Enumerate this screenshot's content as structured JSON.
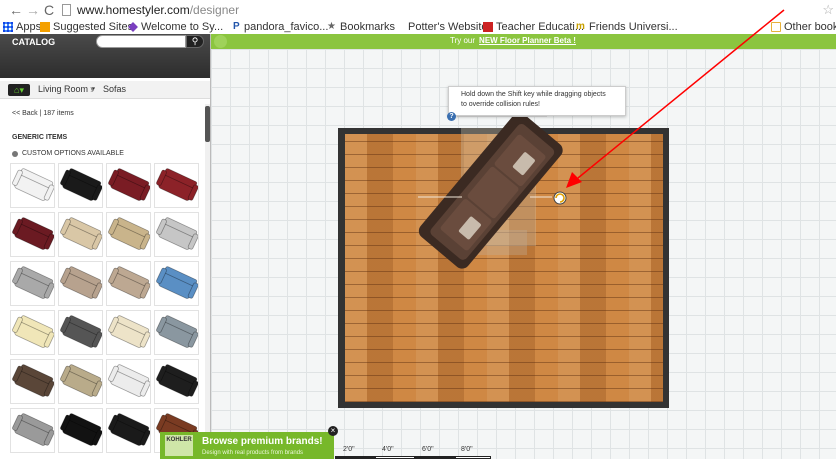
{
  "browser": {
    "url_domain": "www.homestyler.com",
    "url_path": "/designer",
    "back_glyph": "←",
    "forward_glyph": "→",
    "reload_glyph": "C",
    "star_glyph": "☆",
    "bookmarks": [
      {
        "label": "Apps",
        "icon": "apps-grid-icon",
        "color": "#4285f4"
      },
      {
        "label": "Suggested Sites",
        "icon": "suggested-sites-icon",
        "color": "#f4a000"
      },
      {
        "label": "Welcome to Sy...",
        "icon": "welcome-icon",
        "color": "#7a3fc0"
      },
      {
        "label": "pandora_favico...",
        "icon": "pandora-icon",
        "color": "#2255aa"
      },
      {
        "label": "Bookmarks",
        "icon": "star-icon",
        "color": "#666666"
      },
      {
        "label": "Potter's Website",
        "icon": "none",
        "color": ""
      },
      {
        "label": "Teacher Educati...",
        "icon": "teacher-edu-icon",
        "color": "#cc2222"
      },
      {
        "label": "Friends Universi...",
        "icon": "friends-univ-icon",
        "color": "#c8a000"
      },
      {
        "label": "Other bookm",
        "icon": "folder-icon",
        "color": "#e7b13a"
      }
    ]
  },
  "catalog": {
    "title": "CATALOG",
    "search_placeholder": "",
    "search_glyph": "⚲",
    "home_glyph": "⌂▾",
    "room": "Living Room ▾",
    "category": "Sofas",
    "back_text": "<< Back | 187 items",
    "section_heading": "GENERIC ITEMS",
    "custom_options": "CUSTOM OPTIONS AVAILABLE",
    "items": [
      {
        "name": "sofa-white-loveseat",
        "color": "#f2f2f2"
      },
      {
        "name": "sofa-black-leather",
        "color": "#1a1a1a"
      },
      {
        "name": "sofa-burgundy",
        "color": "#7a1c24"
      },
      {
        "name": "sofa-red-leather",
        "color": "#8c2228"
      },
      {
        "name": "sofa-maroon",
        "color": "#6b1a22"
      },
      {
        "name": "sofa-cream-brown",
        "color": "#d9c7a6"
      },
      {
        "name": "sofa-tan-black",
        "color": "#c9b48b"
      },
      {
        "name": "sofa-light-grey",
        "color": "#c6c6c6"
      },
      {
        "name": "sofa-grey-fabric",
        "color": "#a9a9a9"
      },
      {
        "name": "sofa-taupe",
        "color": "#b7a28e"
      },
      {
        "name": "sofa-beige-stripe",
        "color": "#bda892"
      },
      {
        "name": "sofa-sectional-blue",
        "color": "#5a8fc4"
      },
      {
        "name": "chaise-cream",
        "color": "#f0e6b8"
      },
      {
        "name": "chair-dark-grey",
        "color": "#555555"
      },
      {
        "name": "sofa-ivory",
        "color": "#ede3c8"
      },
      {
        "name": "sofa-sectional-grey",
        "color": "#8a97a0"
      },
      {
        "name": "sectional-brown",
        "color": "#5a4638"
      },
      {
        "name": "sofa-khaki",
        "color": "#b9ab8a"
      },
      {
        "name": "sectional-white",
        "color": "#ececec"
      },
      {
        "name": "sofa-black",
        "color": "#1e1e1e"
      },
      {
        "name": "sofa-grey-pleated",
        "color": "#9a9a9a"
      },
      {
        "name": "sectional-black",
        "color": "#121212"
      },
      {
        "name": "sofa-black-tufted",
        "color": "#1a1a1a"
      },
      {
        "name": "sofa-brown",
        "color": "#7a3b22"
      }
    ]
  },
  "canvas": {
    "promo_prefix": "Try our",
    "promo_link": "NEW Floor Planner Beta !",
    "tooltip": "Hold down the Shift key while dragging objects to override collision rules!",
    "help_glyph": "?",
    "ruler_labels": [
      "2'0\"",
      "4'0\"",
      "6'0\"",
      "8'0\""
    ],
    "rotation_handle_icon": "rotate-handle-icon"
  },
  "ad": {
    "logo": "KOHLER",
    "title": "Browse premium brands!",
    "subtitle": "Design with real products from brands",
    "close_glyph": "×"
  },
  "colors": {
    "promo_green": "#8bc53f",
    "annotation_arrow": "#ff0000",
    "floor_wood": "#c9823f",
    "wall": "#333333"
  }
}
